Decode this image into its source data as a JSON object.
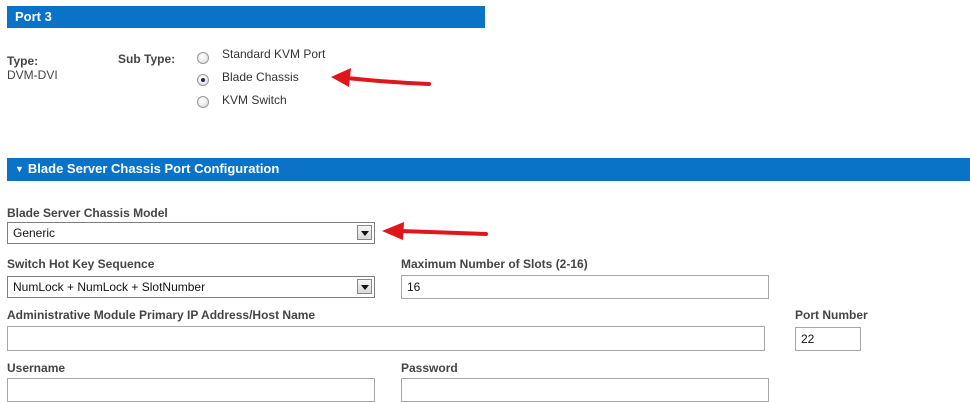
{
  "port_header": {
    "title": "Port 3"
  },
  "type_section": {
    "type_label": "Type:",
    "type_value": "DVM-DVI",
    "subtype_label": "Sub Type:",
    "options": [
      {
        "label": "Standard KVM Port",
        "selected": false
      },
      {
        "label": "Blade Chassis",
        "selected": true
      },
      {
        "label": "KVM Switch",
        "selected": false
      }
    ]
  },
  "blade_section": {
    "toggle_glyph": "▼",
    "title": "Blade Server Chassis Port Configuration"
  },
  "form": {
    "model_label": "Blade Server Chassis Model",
    "model_value": "Generic",
    "hotkey_label": "Switch Hot Key Sequence",
    "hotkey_value": "NumLock + NumLock + SlotNumber",
    "max_slots_label": "Maximum Number of Slots (2-16)",
    "max_slots_value": "16",
    "admin_ip_label": "Administrative Module Primary IP Address/Host Name",
    "admin_ip_value": "",
    "port_number_label": "Port Number",
    "port_number_value": "22",
    "username_label": "Username",
    "username_value": "",
    "password_label": "Password",
    "password_value": ""
  },
  "annotations": {
    "arrow_color": "#e0161c"
  },
  "colors": {
    "header_bar": "#0a72c7"
  }
}
